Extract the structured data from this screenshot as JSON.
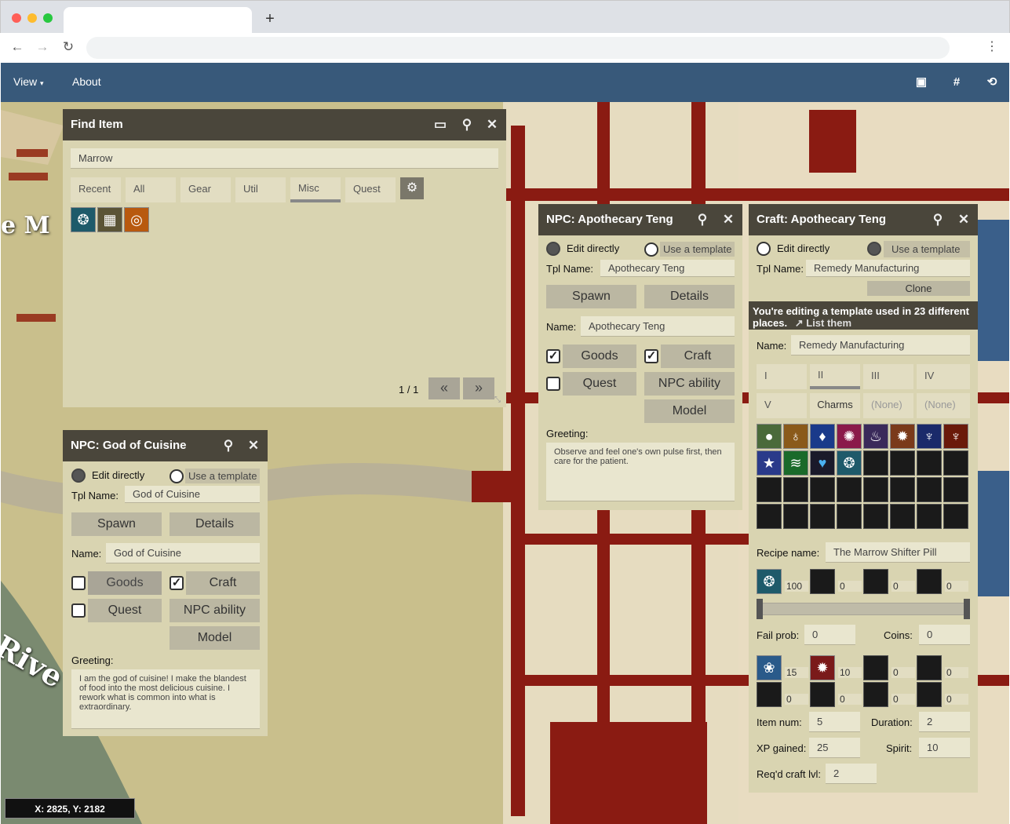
{
  "browser": {
    "new_tab": "+",
    "back": "←",
    "forward": "→",
    "reload": "↻",
    "menu": "⋮"
  },
  "appbar": {
    "view": "View",
    "about": "About"
  },
  "map": {
    "labels": [
      "e M",
      "Rive"
    ],
    "coords": "X: 2825, Y: 2182"
  },
  "find_item": {
    "title": "Find Item",
    "search_value": "Marrow",
    "tabs": [
      {
        "label": "Recent"
      },
      {
        "label": "All"
      },
      {
        "label": "Gear"
      },
      {
        "label": "Util"
      },
      {
        "label": "Misc"
      },
      {
        "label": "Quest"
      }
    ],
    "active_tab": "Misc",
    "results": [
      "marrow-pill-icon",
      "chest-icon",
      "target-charm-icon"
    ],
    "pager": "1 / 1",
    "prev": "«",
    "next": "»"
  },
  "npc_teng": {
    "title": "NPC: Apothecary Teng",
    "edit_directly": "Edit directly",
    "use_template": "Use a template",
    "tpl_name_label": "Tpl Name:",
    "tpl_name": "Apothecary Teng",
    "spawn": "Spawn",
    "details": "Details",
    "name_label": "Name:",
    "name": "Apothecary Teng",
    "goods": "Goods",
    "craft": "Craft",
    "quest": "Quest",
    "npc_ability": "NPC ability",
    "model": "Model",
    "greeting_label": "Greeting:",
    "greeting": "Observe and feel one's own pulse first, then care for the patient.",
    "goods_checked": true,
    "craft_checked": true,
    "quest_checked": false
  },
  "npc_cuisine": {
    "title": "NPC: God of Cuisine",
    "edit_directly": "Edit directly",
    "use_template": "Use a template",
    "tpl_name_label": "Tpl Name:",
    "tpl_name": "God of Cuisine",
    "spawn": "Spawn",
    "details": "Details",
    "name_label": "Name:",
    "name": "God of Cuisine",
    "goods": "Goods",
    "craft": "Craft",
    "quest": "Quest",
    "npc_ability": "NPC ability",
    "model": "Model",
    "greeting_label": "Greeting:",
    "greeting": "I am the god of cuisine! I make the blandest of food into the most delicious cuisine. I rework what is common into what is extraordinary.",
    "goods_checked": false,
    "craft_checked": true,
    "quest_checked": false
  },
  "craft": {
    "title": "Craft: Apothecary Teng",
    "edit_directly": "Edit directly",
    "use_template": "Use a template",
    "tpl_name_label": "Tpl Name:",
    "tpl_name": "Remedy Manufacturing",
    "clone": "Clone",
    "warning": "You're editing a template used in 23 different places.",
    "list_them": "List them",
    "name_label": "Name:",
    "name": "Remedy Manufacturing",
    "tabs": [
      "I",
      "II",
      "III",
      "IV",
      "V",
      "Charms",
      "(None)",
      "(None)"
    ],
    "active_tab": "II",
    "grid_icons": [
      "green-orb-icon",
      "pouch-icon",
      "blue-vial-icon",
      "red-burst-icon",
      "potion-icon",
      "cookie-icon",
      "blue-flame-icon",
      "red-flame-icon",
      "star-icon",
      "green-scroll-icon",
      "heart-icon",
      "marrow-pill-icon"
    ],
    "recipe_label": "Recipe name:",
    "recipe_name": "The Marrow Shifter Pill",
    "output_counts": [
      "100",
      "0",
      "0",
      "0"
    ],
    "fail_label": "Fail prob:",
    "fail_prob": "0",
    "coins_label": "Coins:",
    "coins": "0",
    "material_counts": [
      "15",
      "10",
      "0",
      "0",
      "0",
      "0",
      "0",
      "0"
    ],
    "item_num_label": "Item num:",
    "item_num": "5",
    "duration_label": "Duration:",
    "duration": "2",
    "xp_label": "XP gained:",
    "xp": "25",
    "spirit_label": "Spirit:",
    "spirit": "10",
    "craft_lvl_label": "Req'd craft lvl:",
    "craft_lvl": "2"
  },
  "colors": {
    "header": "#4a463b",
    "panel": "#d9d4b1",
    "appbar": "#234b78",
    "road": "#8a1b12"
  }
}
